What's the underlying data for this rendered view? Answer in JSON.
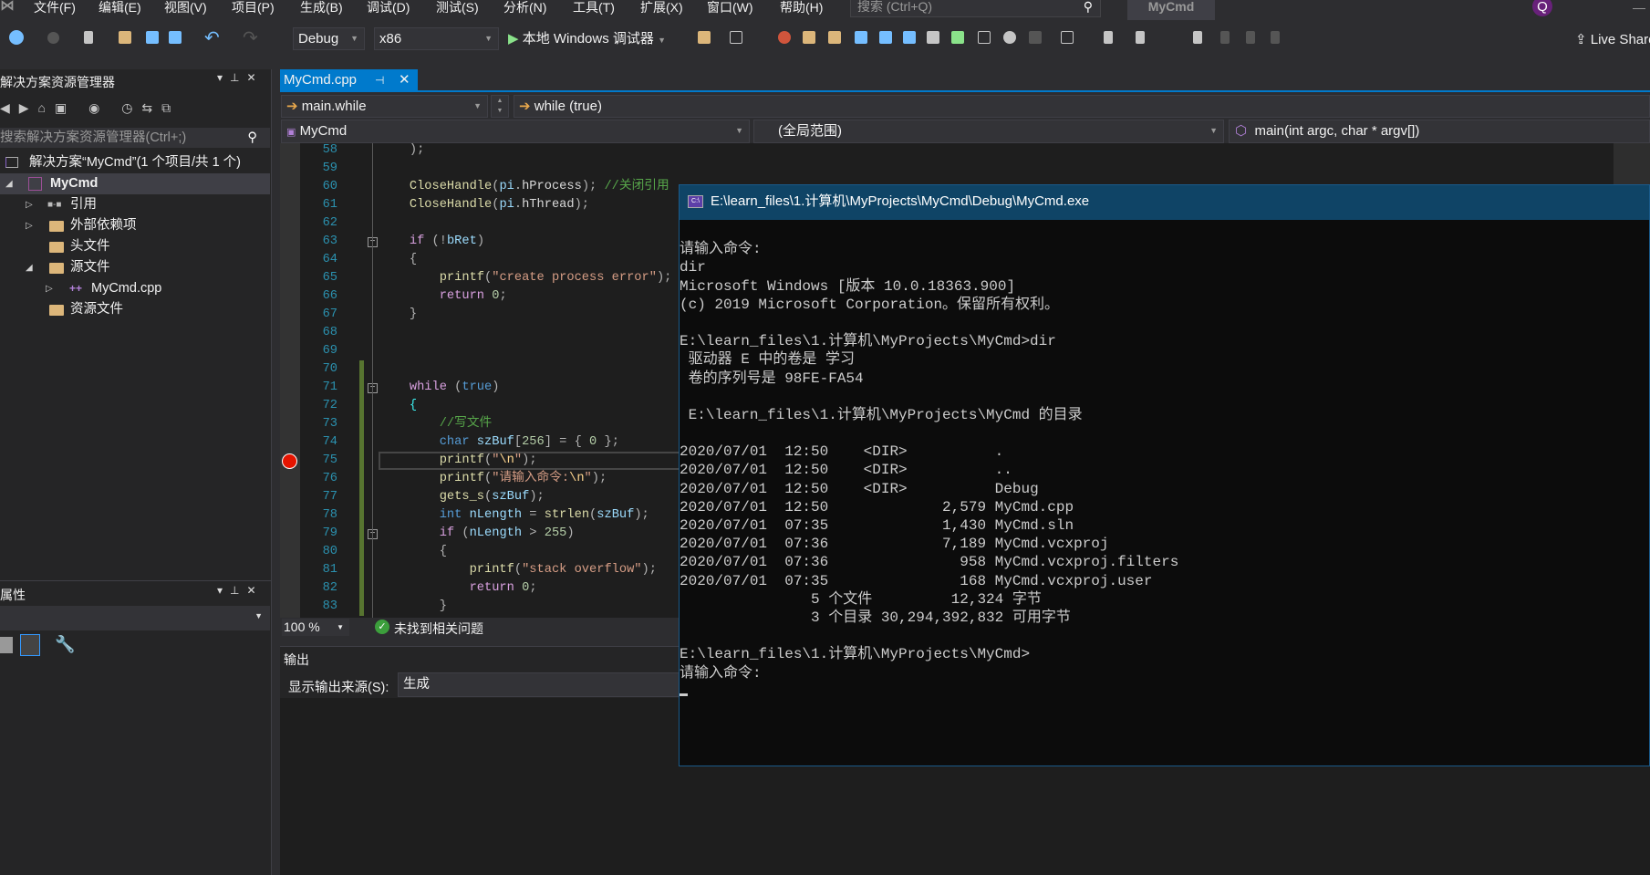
{
  "menu": [
    "文件(F)",
    "编辑(E)",
    "视图(V)",
    "项目(P)",
    "生成(B)",
    "调试(D)",
    "测试(S)",
    "分析(N)",
    "工具(T)",
    "扩展(X)",
    "窗口(W)",
    "帮助(H)"
  ],
  "search": {
    "placeholder": "搜索 (Ctrl+Q)"
  },
  "title": "MyCmd",
  "avatar": "Q",
  "toolbar": {
    "config": "Debug",
    "platform": "x86",
    "start_label": "本地 Windows 调试器",
    "live_share": "Live Share"
  },
  "solution_explorer": {
    "title": "解决方案资源管理器",
    "search_placeholder": "搜索解决方案资源管理器(Ctrl+;)",
    "solution": "解决方案“MyCmd”(1 个项目/共 1 个)",
    "project": "MyCmd",
    "items": [
      "引用",
      "外部依赖项",
      "头文件",
      "源文件",
      "MyCmd.cpp",
      "资源文件"
    ]
  },
  "properties": {
    "title": "属性"
  },
  "editor": {
    "tab": "MyCmd.cpp",
    "nav_scope": "main.while",
    "nav_member": "while (true)",
    "project_combo": "MyCmd",
    "scope_combo": "(全局范围)",
    "function_combo": "main(int argc, char * argv[])",
    "zoom": "100 %",
    "issues": "未找到相关问题",
    "breakpoint_line": 75,
    "current_line": 75,
    "lines": [
      {
        "n": 58,
        "tokens": [
          [
            "    );",
            "p"
          ]
        ]
      },
      {
        "n": 59,
        "tokens": []
      },
      {
        "n": 60,
        "tokens": [
          [
            "    ",
            "p"
          ],
          [
            "CloseHandle",
            "fn"
          ],
          [
            "(",
            "p"
          ],
          [
            "pi",
            "v"
          ],
          [
            ".",
            "p"
          ],
          [
            "hProcess",
            "w"
          ],
          [
            ");",
            "p"
          ],
          [
            " //关闭引用",
            "c"
          ]
        ]
      },
      {
        "n": 61,
        "tokens": [
          [
            "    ",
            "p"
          ],
          [
            "CloseHandle",
            "fn"
          ],
          [
            "(",
            "p"
          ],
          [
            "pi",
            "v"
          ],
          [
            ".",
            "p"
          ],
          [
            "hThread",
            "w"
          ],
          [
            ");",
            "p"
          ]
        ]
      },
      {
        "n": 62,
        "tokens": []
      },
      {
        "n": 63,
        "tokens": [
          [
            "    ",
            "p"
          ],
          [
            "if",
            "ctl"
          ],
          [
            " (!",
            "p"
          ],
          [
            "bRet",
            "v"
          ],
          [
            ")",
            "p"
          ]
        ]
      },
      {
        "n": 64,
        "tokens": [
          [
            "    {",
            "p"
          ]
        ]
      },
      {
        "n": 65,
        "tokens": [
          [
            "        ",
            "p"
          ],
          [
            "printf",
            "fn"
          ],
          [
            "(",
            "p"
          ],
          [
            "\"create process error\"",
            "s"
          ],
          [
            ");",
            "p"
          ]
        ]
      },
      {
        "n": 66,
        "tokens": [
          [
            "        ",
            "p"
          ],
          [
            "return",
            "ctl"
          ],
          [
            " ",
            "p"
          ],
          [
            "0",
            "n"
          ],
          [
            ";",
            "p"
          ]
        ]
      },
      {
        "n": 67,
        "tokens": [
          [
            "    }",
            "p"
          ]
        ]
      },
      {
        "n": 68,
        "tokens": []
      },
      {
        "n": 69,
        "tokens": []
      },
      {
        "n": 70,
        "tokens": []
      },
      {
        "n": 71,
        "tokens": [
          [
            "    ",
            "p"
          ],
          [
            "while",
            "ctl"
          ],
          [
            " (",
            "p"
          ],
          [
            "true",
            "k"
          ],
          [
            ")",
            "p"
          ]
        ]
      },
      {
        "n": 72,
        "tokens": [
          [
            "    ",
            "p"
          ],
          [
            "{",
            "br"
          ]
        ]
      },
      {
        "n": 73,
        "tokens": [
          [
            "        ",
            "p"
          ],
          [
            "//写文件",
            "c"
          ]
        ]
      },
      {
        "n": 74,
        "tokens": [
          [
            "        ",
            "p"
          ],
          [
            "char",
            "k"
          ],
          [
            " ",
            "p"
          ],
          [
            "szBuf",
            "v"
          ],
          [
            "[",
            "p"
          ],
          [
            "256",
            "n"
          ],
          [
            "] = { ",
            "p"
          ],
          [
            "0",
            "n"
          ],
          [
            " };",
            "p"
          ]
        ]
      },
      {
        "n": 75,
        "tokens": [
          [
            "        ",
            "p"
          ],
          [
            "printf",
            "fn"
          ],
          [
            "(",
            "p"
          ],
          [
            "\"",
            "s"
          ],
          [
            "\\n",
            "esc"
          ],
          [
            "\"",
            "s"
          ],
          [
            ");",
            "p"
          ]
        ]
      },
      {
        "n": 76,
        "tokens": [
          [
            "        ",
            "p"
          ],
          [
            "printf",
            "fn"
          ],
          [
            "(",
            "p"
          ],
          [
            "\"请输入命令:",
            "s"
          ],
          [
            "\\n",
            "esc"
          ],
          [
            "\"",
            "s"
          ],
          [
            ");",
            "p"
          ]
        ]
      },
      {
        "n": 77,
        "tokens": [
          [
            "        ",
            "p"
          ],
          [
            "gets_s",
            "fn"
          ],
          [
            "(",
            "p"
          ],
          [
            "szBuf",
            "v"
          ],
          [
            ");",
            "p"
          ]
        ]
      },
      {
        "n": 78,
        "tokens": [
          [
            "        ",
            "p"
          ],
          [
            "int",
            "k"
          ],
          [
            " ",
            "p"
          ],
          [
            "nLength",
            "v"
          ],
          [
            " = ",
            "p"
          ],
          [
            "strlen",
            "fn"
          ],
          [
            "(",
            "p"
          ],
          [
            "szBuf",
            "v"
          ],
          [
            ");",
            "p"
          ]
        ]
      },
      {
        "n": 79,
        "tokens": [
          [
            "        ",
            "p"
          ],
          [
            "if",
            "ctl"
          ],
          [
            " (",
            "p"
          ],
          [
            "nLength",
            "v"
          ],
          [
            " > ",
            "p"
          ],
          [
            "255",
            "n"
          ],
          [
            ")",
            "p"
          ]
        ]
      },
      {
        "n": 80,
        "tokens": [
          [
            "        {",
            "p"
          ]
        ]
      },
      {
        "n": 81,
        "tokens": [
          [
            "            ",
            "p"
          ],
          [
            "printf",
            "fn"
          ],
          [
            "(",
            "p"
          ],
          [
            "\"stack overflow\"",
            "s"
          ],
          [
            ");",
            "p"
          ]
        ]
      },
      {
        "n": 82,
        "tokens": [
          [
            "            ",
            "p"
          ],
          [
            "return",
            "ctl"
          ],
          [
            " ",
            "p"
          ],
          [
            "0",
            "n"
          ],
          [
            ";",
            "p"
          ]
        ]
      },
      {
        "n": 83,
        "tokens": [
          [
            "        }",
            "p"
          ]
        ]
      }
    ]
  },
  "output": {
    "title": "输出",
    "source_label": "显示输出来源(S):",
    "source_value": "生成"
  },
  "console": {
    "title": "E:\\learn_files\\1.计算机\\MyProjects\\MyCmd\\Debug\\MyCmd.exe",
    "lines": [
      "",
      "请输入命令:",
      "dir",
      "Microsoft Windows [版本 10.0.18363.900]",
      "(c) 2019 Microsoft Corporation。保留所有权利。",
      "",
      "E:\\learn_files\\1.计算机\\MyProjects\\MyCmd>dir",
      " 驱动器 E 中的卷是 学习",
      " 卷的序列号是 98FE-FA54",
      "",
      " E:\\learn_files\\1.计算机\\MyProjects\\MyCmd 的目录",
      "",
      "2020/07/01  12:50    <DIR>          .",
      "2020/07/01  12:50    <DIR>          ..",
      "2020/07/01  12:50    <DIR>          Debug",
      "2020/07/01  12:50             2,579 MyCmd.cpp",
      "2020/07/01  07:35             1,430 MyCmd.sln",
      "2020/07/01  07:36             7,189 MyCmd.vcxproj",
      "2020/07/01  07:36               958 MyCmd.vcxproj.filters",
      "2020/07/01  07:35               168 MyCmd.vcxproj.user",
      "               5 个文件         12,324 字节",
      "               3 个目录 30,294,392,832 可用字节",
      "",
      "E:\\learn_files\\1.计算机\\MyProjects\\MyCmd>",
      "请输入命令:"
    ]
  },
  "colors": {
    "accent": "#007acc",
    "console_title_bg": "#0f4466",
    "breakpoint": "#e51400",
    "change_bar": "#577430"
  }
}
